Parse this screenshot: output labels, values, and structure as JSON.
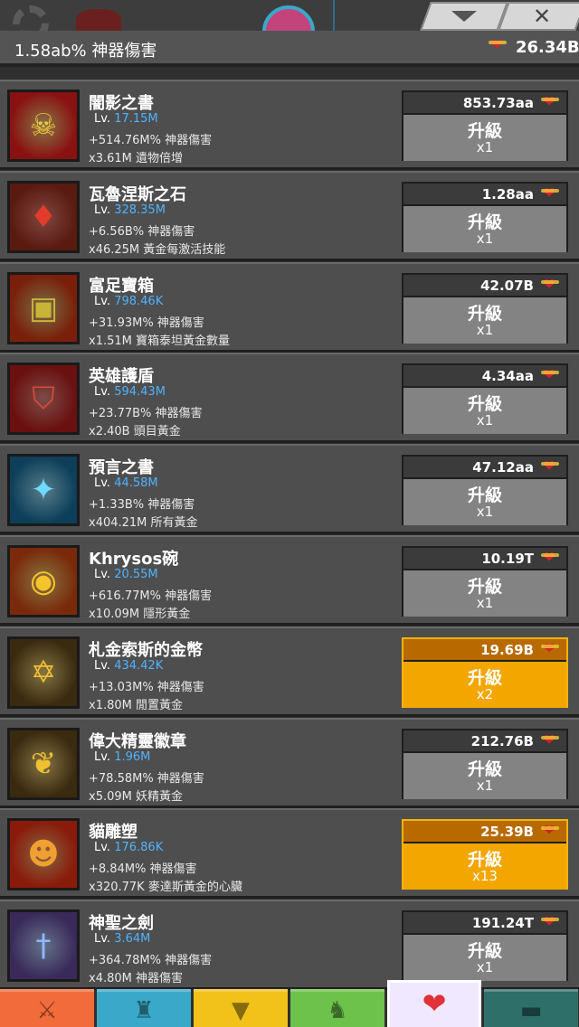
{
  "header": {
    "artifact_damage": "1.58ab% 神器傷害",
    "gold": "26.34B",
    "gold_icon": "heart-coin-icon"
  },
  "top_controls": {
    "collapse_icon": "chevron-down-icon",
    "close_icon": "close-icon"
  },
  "artifacts": [
    {
      "name": "闇影之書",
      "lv_prefix": "Lv.",
      "level": "17.15M",
      "bonus1": "+514.76M% 神器傷害",
      "bonus2": "x3.61M 遺物倍增",
      "cost": "853.73aa",
      "upgrade": "升級",
      "mult": "x1",
      "icon": "shadow-book-icon",
      "glyph": "☠",
      "bg": "#8a1111",
      "fg": "#f3c93b",
      "affordable": false
    },
    {
      "name": "瓦魯涅斯之石",
      "lv_prefix": "Lv.",
      "level": "328.35M",
      "bonus1": "+6.56B% 神器傷害",
      "bonus2": "x46.25M 黃金每激活技能",
      "cost": "1.28aa",
      "upgrade": "升級",
      "mult": "x1",
      "icon": "gem-amulet-icon",
      "glyph": "♦",
      "bg": "#5a1a10",
      "fg": "#e23b2a",
      "affordable": false
    },
    {
      "name": "富足寶箱",
      "lv_prefix": "Lv.",
      "level": "798.46K",
      "bonus1": "+31.93M% 神器傷害",
      "bonus2": "x1.51M 寶箱泰坦黃金數量",
      "cost": "42.07B",
      "upgrade": "升級",
      "mult": "x1",
      "icon": "treasure-chest-icon",
      "glyph": "▣",
      "bg": "#7a1f0a",
      "fg": "#c9b43a",
      "affordable": false
    },
    {
      "name": "英雄護盾",
      "lv_prefix": "Lv.",
      "level": "594.43M",
      "bonus1": "+23.77B% 神器傷害",
      "bonus2": "x2.40B 頭目黃金",
      "cost": "4.34aa",
      "upgrade": "升級",
      "mult": "x1",
      "icon": "shield-icon",
      "glyph": "⛉",
      "bg": "#6a1010",
      "fg": "#d84a3a",
      "affordable": false
    },
    {
      "name": "預言之書",
      "lv_prefix": "Lv.",
      "level": "44.58M",
      "bonus1": "+1.33B% 神器傷害",
      "bonus2": "x404.21M 所有黃金",
      "cost": "47.12aa",
      "upgrade": "升級",
      "mult": "x1",
      "icon": "prophecy-book-icon",
      "glyph": "✦",
      "bg": "#0d3f5a",
      "fg": "#6fd9ff",
      "affordable": false
    },
    {
      "name": "Khrysos碗",
      "lv_prefix": "Lv.",
      "level": "20.55M",
      "bonus1": "+616.77M% 神器傷害",
      "bonus2": "x10.09M 隱形黃金",
      "cost": "10.19T",
      "upgrade": "升級",
      "mult": "x1",
      "icon": "golden-bowl-icon",
      "glyph": "◉",
      "bg": "#7a2a0a",
      "fg": "#f5c42a",
      "affordable": false
    },
    {
      "name": "札金索斯的金幣",
      "lv_prefix": "Lv.",
      "level": "434.42K",
      "bonus1": "+13.03M% 神器傷害",
      "bonus2": "x1.80M 閒置黃金",
      "cost": "19.69B",
      "upgrade": "升級",
      "mult": "x2",
      "icon": "gold-coin-icon",
      "glyph": "✡",
      "bg": "#3a2a10",
      "fg": "#f0c030",
      "affordable": true
    },
    {
      "name": "偉大精靈徽章",
      "lv_prefix": "Lv.",
      "level": "1.96M",
      "bonus1": "+78.58M% 神器傷害",
      "bonus2": "x5.09M 妖精黃金",
      "cost": "212.76B",
      "upgrade": "升級",
      "mult": "x1",
      "icon": "fairy-medal-icon",
      "glyph": "❦",
      "bg": "#3a2a10",
      "fg": "#f0c030",
      "affordable": false
    },
    {
      "name": "貓雕塑",
      "lv_prefix": "Lv.",
      "level": "176.86K",
      "bonus1": "+8.84M% 神器傷害",
      "bonus2": "x320.77K 麥達斯黃金的心臟",
      "cost": "25.39B",
      "upgrade": "升級",
      "mult": "x13",
      "icon": "cat-statue-icon",
      "glyph": "☻",
      "bg": "#8a1a0a",
      "fg": "#f0a030",
      "affordable": true
    },
    {
      "name": "神聖之劍",
      "lv_prefix": "Lv.",
      "level": "3.64M",
      "bonus1": "+364.78M% 神器傷害",
      "bonus2": "x4.80M 神器傷害",
      "cost": "191.24T",
      "upgrade": "升級",
      "mult": "x1",
      "icon": "holy-sword-icon",
      "glyph": "†",
      "bg": "#3a2a5a",
      "fg": "#8fb8ff",
      "affordable": false
    }
  ],
  "bottom_tabs": [
    {
      "name": "sword-master",
      "icon": "sword-icon",
      "glyph": "⚔",
      "color": "#f26b3a"
    },
    {
      "name": "heroes",
      "icon": "viking-helmet-icon",
      "glyph": "♜",
      "color": "#3aa9c9"
    },
    {
      "name": "equipment",
      "icon": "armor-icon",
      "glyph": "▼",
      "color": "#f2c21a"
    },
    {
      "name": "pets",
      "icon": "pet-icon",
      "glyph": "♞",
      "color": "#6cc24a"
    },
    {
      "name": "artifacts",
      "icon": "heart-artifact-icon",
      "glyph": "❤",
      "color": "#efe8ff",
      "selected": true
    },
    {
      "name": "shop",
      "icon": "chest-icon",
      "glyph": "▬",
      "color": "#2f6f6a"
    }
  ]
}
